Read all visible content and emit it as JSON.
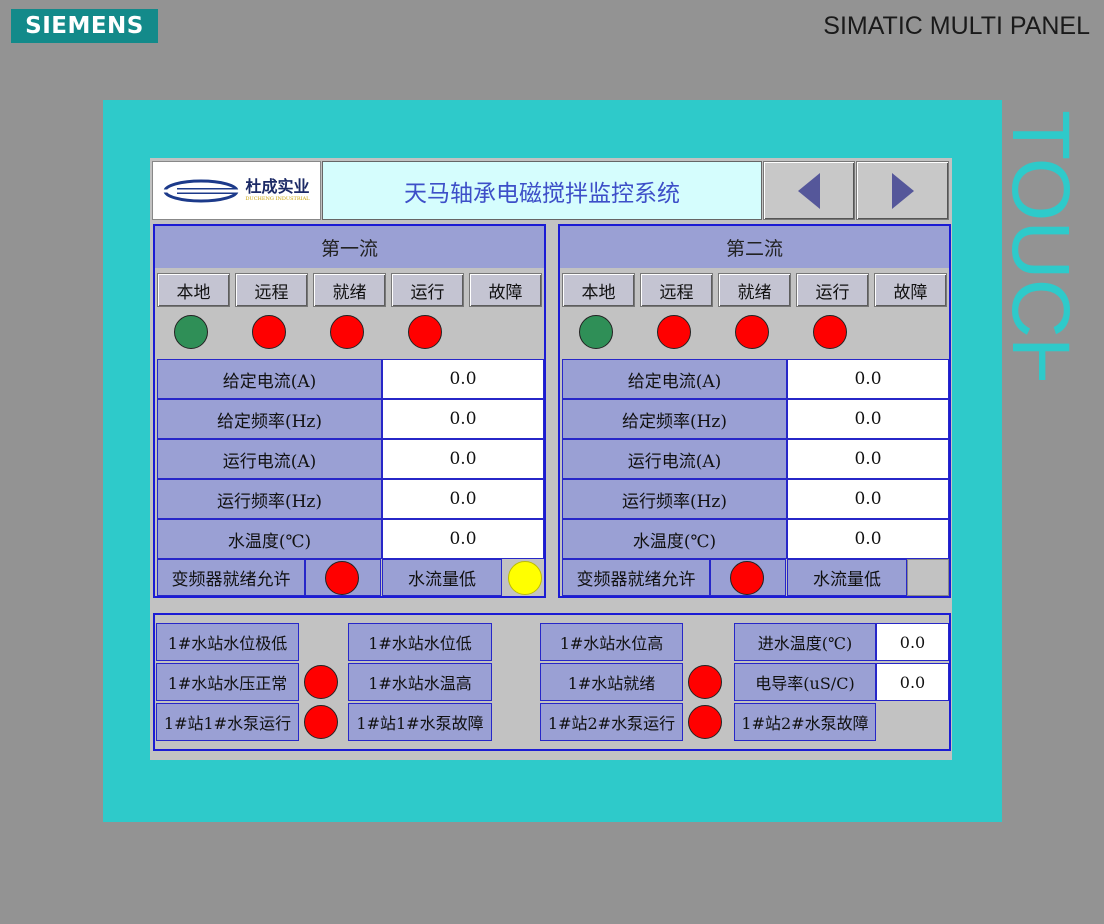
{
  "device": {
    "brand": "SIEMENS",
    "model": "SIMATIC MULTI PANEL",
    "touch_label": "TOUCH"
  },
  "header": {
    "company_name": "杜成实业",
    "company_sub": "DUCHENG INDUSTRIAL",
    "title": "天马轴承电磁搅拌监控系统",
    "prev_icon": "left-triangle-icon",
    "next_icon": "right-triangle-icon"
  },
  "colors": {
    "lamp_green": "#2f8f57",
    "lamp_red": "#ff0000",
    "lamp_yellow": "#ffff00",
    "bezel": "#2ecaca",
    "border_blue": "#1b1bd4"
  },
  "stream1": {
    "title": "第一流",
    "buttons": [
      "本地",
      "远程",
      "就绪",
      "运行",
      "故障"
    ],
    "rows": [
      {
        "label": "给定电流(A)",
        "value": "0.0"
      },
      {
        "label": "给定频率(Hz)",
        "value": "0.0"
      },
      {
        "label": "运行电流(A)",
        "value": "0.0"
      },
      {
        "label": "运行频率(Hz)",
        "value": "0.0"
      },
      {
        "label": "水温度(℃)",
        "value": "0.0"
      }
    ],
    "vfd_ready_label": "变频器就绪允许",
    "water_flow_low_label": "水流量低"
  },
  "stream2": {
    "title": "第二流",
    "buttons": [
      "本地",
      "远程",
      "就绪",
      "运行",
      "故障"
    ],
    "rows": [
      {
        "label": "给定电流(A)",
        "value": "0.0"
      },
      {
        "label": "给定频率(Hz)",
        "value": "0.0"
      },
      {
        "label": "运行电流(A)",
        "value": "0.0"
      },
      {
        "label": "运行频率(Hz)",
        "value": "0.0"
      },
      {
        "label": "水温度(℃)",
        "value": "0.0"
      }
    ],
    "vfd_ready_label": "变频器就绪允许",
    "water_flow_low_label": "水流量低"
  },
  "water_station": {
    "level_very_low": "1#水站水位极低",
    "level_low": "1#水站水位低",
    "level_high": "1#水站水位高",
    "inlet_temp_label": "进水温度(℃)",
    "inlet_temp_value": "0.0",
    "pressure_normal": "1#水站水压正常",
    "temp_high": "1#水站水温高",
    "station_ready": "1#水站就绪",
    "conductivity_label": "电导率(uS/C)",
    "conductivity_value": "0.0",
    "pump1_run": "1#站1#水泵运行",
    "pump1_fault": "1#站1#水泵故障",
    "pump2_run": "1#站2#水泵运行",
    "pump2_fault": "1#站2#水泵故障"
  }
}
